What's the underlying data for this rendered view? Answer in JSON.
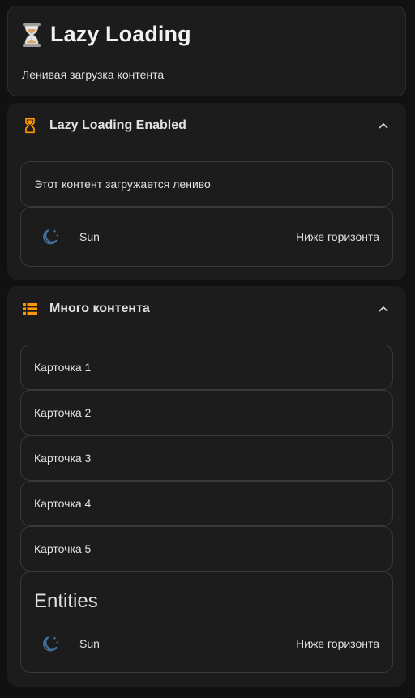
{
  "header": {
    "emoji": "⏳",
    "title": "Lazy Loading",
    "subtitle": "Ленивая загрузка контента"
  },
  "lazy_section": {
    "icon": "hourglass-icon",
    "title": "Lazy Loading Enabled",
    "content_text": "Этот контент загружается лениво",
    "entity": {
      "icon": "weather-night-icon",
      "name": "Sun",
      "state": "Ниже горизонта"
    }
  },
  "content_section": {
    "icon": "view-list-icon",
    "title": "Много контента",
    "cards": [
      "Карточка 1",
      "Карточка 2",
      "Карточка 3",
      "Карточка 4",
      "Карточка 5"
    ],
    "entities_card": {
      "title": "Entities",
      "entity": {
        "icon": "weather-night-icon",
        "name": "Sun",
        "state": "Ниже горизонта"
      }
    }
  },
  "colors": {
    "background": "#111111",
    "card": "#1c1c1c",
    "accent_orange": "#ff9800",
    "icon_blue": "#44739e",
    "text": "#e1e1e1"
  }
}
